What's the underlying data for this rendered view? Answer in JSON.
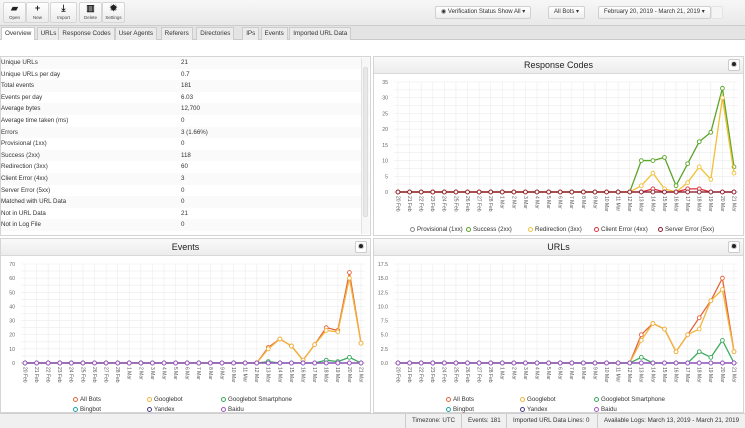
{
  "toolbar": {
    "buttons": [
      {
        "label": "Open",
        "icon": "folder-open-icon",
        "glyph": "▰"
      },
      {
        "label": "New",
        "icon": "plus-icon",
        "glyph": "+"
      },
      {
        "label": "Import",
        "icon": "download-icon",
        "glyph": "⤓"
      },
      {
        "label": "Delete",
        "icon": "trash-icon",
        "glyph": "▥"
      },
      {
        "label": "Settings",
        "icon": "gear-icon",
        "glyph": "✹"
      }
    ],
    "verification_filter": "Verification Status Show All",
    "bots_filter": "All Bots",
    "date_range": "February 20, 2019 - March 21, 2019"
  },
  "tabs": [
    "Overview",
    "URLs",
    "Response Codes",
    "User Agents",
    "Referers",
    "Directories",
    "IPs",
    "Events",
    "Imported URL Data"
  ],
  "active_tab": "Overview",
  "stats": [
    [
      "Unique URLs",
      "21"
    ],
    [
      "Unique URLs per day",
      "0.7"
    ],
    [
      "Total events",
      "181"
    ],
    [
      "Events per day",
      "6.03"
    ],
    [
      "Average bytes",
      "12,700"
    ],
    [
      "Average time taken (ms)",
      "0"
    ],
    [
      "Errors",
      "3 (1.66%)"
    ],
    [
      "Provisional (1xx)",
      "0"
    ],
    [
      "Success (2xx)",
      "118"
    ],
    [
      "Redirection (3xx)",
      "60"
    ],
    [
      "Client Error (4xx)",
      "3"
    ],
    [
      "Server Error (5xx)",
      "0"
    ],
    [
      "Matched with URL Data",
      "0"
    ],
    [
      "Not in URL Data",
      "21"
    ],
    [
      "Not in Log File",
      "0"
    ]
  ],
  "chart_data": [
    {
      "id": "response",
      "title": "Response Codes",
      "type": "line",
      "ylim": [
        0,
        35
      ],
      "yticks": [
        0,
        5,
        10,
        15,
        20,
        25,
        30,
        35
      ],
      "grid": true,
      "legend": "bottom",
      "categories": [
        "20 Feb",
        "21 Feb",
        "22 Feb",
        "23 Feb",
        "24 Feb",
        "25 Feb",
        "26 Feb",
        "27 Feb",
        "28 Feb",
        "1 Mar",
        "2 Mar",
        "3 Mar",
        "4 Mar",
        "5 Mar",
        "6 Mar",
        "7 Mar",
        "8 Mar",
        "9 Mar",
        "10 Mar",
        "11 Mar",
        "12 Mar",
        "13 Mar",
        "14 Mar",
        "15 Mar",
        "16 Mar",
        "17 Mar",
        "18 Mar",
        "19 Mar",
        "20 Mar",
        "21 Mar"
      ],
      "series": [
        {
          "name": "Provisional (1xx)",
          "color": "#8a8a8a",
          "values": [
            0,
            0,
            0,
            0,
            0,
            0,
            0,
            0,
            0,
            0,
            0,
            0,
            0,
            0,
            0,
            0,
            0,
            0,
            0,
            0,
            0,
            0,
            0,
            0,
            0,
            0,
            0,
            0,
            0,
            0
          ]
        },
        {
          "name": "Success (2xx)",
          "color": "#5aa52a",
          "values": [
            0,
            0,
            0,
            0,
            0,
            0,
            0,
            0,
            0,
            0,
            0,
            0,
            0,
            0,
            0,
            0,
            0,
            0,
            0,
            0,
            0,
            10,
            10,
            11,
            2,
            9,
            16,
            19,
            33,
            8
          ]
        },
        {
          "name": "Redirection (3xx)",
          "color": "#f0c038",
          "values": [
            0,
            0,
            0,
            0,
            0,
            0,
            0,
            0,
            0,
            0,
            0,
            0,
            0,
            0,
            0,
            0,
            0,
            0,
            0,
            0,
            0,
            2,
            6,
            1,
            0,
            3,
            8,
            4,
            30,
            6
          ]
        },
        {
          "name": "Client Error (4xx)",
          "color": "#d8323c",
          "values": [
            0,
            0,
            0,
            0,
            0,
            0,
            0,
            0,
            0,
            0,
            0,
            0,
            0,
            0,
            0,
            0,
            0,
            0,
            0,
            0,
            0,
            0,
            1,
            0,
            0,
            1,
            1,
            0,
            0,
            0
          ]
        },
        {
          "name": "Server Error (5xx)",
          "color": "#8e1c2e",
          "values": [
            0,
            0,
            0,
            0,
            0,
            0,
            0,
            0,
            0,
            0,
            0,
            0,
            0,
            0,
            0,
            0,
            0,
            0,
            0,
            0,
            0,
            0,
            0,
            0,
            0,
            0,
            0,
            0,
            0,
            0
          ]
        }
      ]
    },
    {
      "id": "events",
      "title": "Events",
      "type": "line",
      "ylim": [
        0,
        70
      ],
      "yticks": [
        0,
        10,
        20,
        30,
        40,
        50,
        60,
        70
      ],
      "grid": true,
      "legend": "bottom",
      "series": [
        {
          "name": "All Bots",
          "color": "#e4663a",
          "values": [
            0,
            0,
            0,
            0,
            0,
            0,
            0,
            0,
            0,
            0,
            0,
            0,
            0,
            0,
            0,
            0,
            0,
            0,
            0,
            0,
            0,
            11,
            17,
            12,
            2,
            13,
            25,
            23,
            64,
            14
          ]
        },
        {
          "name": "Googlebot",
          "color": "#f2b53c",
          "values": [
            0,
            0,
            0,
            0,
            0,
            0,
            0,
            0,
            0,
            0,
            0,
            0,
            0,
            0,
            0,
            0,
            0,
            0,
            0,
            0,
            0,
            10,
            17,
            12,
            2,
            13,
            23,
            22,
            60,
            14
          ]
        },
        {
          "name": "Googlebot Smartphone",
          "color": "#3aaa5c",
          "values": [
            0,
            0,
            0,
            0,
            0,
            0,
            0,
            0,
            0,
            0,
            0,
            0,
            0,
            0,
            0,
            0,
            0,
            0,
            0,
            0,
            0,
            1,
            0,
            0,
            0,
            0,
            2,
            1,
            4,
            0
          ]
        },
        {
          "name": "Bingbot",
          "color": "#1fa3a6",
          "values": [
            0,
            0,
            0,
            0,
            0,
            0,
            0,
            0,
            0,
            0,
            0,
            0,
            0,
            0,
            0,
            0,
            0,
            0,
            0,
            0,
            0,
            0,
            0,
            0,
            0,
            0,
            0,
            0,
            0,
            0
          ]
        },
        {
          "name": "Yandex",
          "color": "#4a3c8c",
          "values": [
            0,
            0,
            0,
            0,
            0,
            0,
            0,
            0,
            0,
            0,
            0,
            0,
            0,
            0,
            0,
            0,
            0,
            0,
            0,
            0,
            0,
            0,
            0,
            0,
            0,
            0,
            0,
            0,
            0,
            0
          ]
        },
        {
          "name": "Baidu",
          "color": "#a455c4",
          "values": [
            0,
            0,
            0,
            0,
            0,
            0,
            0,
            0,
            0,
            0,
            0,
            0,
            0,
            0,
            0,
            0,
            0,
            0,
            0,
            0,
            0,
            0,
            0,
            0,
            0,
            0,
            0,
            0,
            0,
            0
          ]
        }
      ]
    },
    {
      "id": "urls",
      "title": "URLs",
      "type": "line",
      "ylim": [
        0,
        17.5
      ],
      "yticks": [
        0,
        2.5,
        5,
        7.5,
        10,
        12.5,
        15,
        17.5
      ],
      "grid": true,
      "legend": "bottom",
      "series": [
        {
          "name": "All Bots",
          "color": "#e4663a",
          "values": [
            0,
            0,
            0,
            0,
            0,
            0,
            0,
            0,
            0,
            0,
            0,
            0,
            0,
            0,
            0,
            0,
            0,
            0,
            0,
            0,
            0,
            5,
            7,
            6,
            2,
            5,
            8,
            11,
            15,
            2
          ]
        },
        {
          "name": "Googlebot",
          "color": "#f2b53c",
          "values": [
            0,
            0,
            0,
            0,
            0,
            0,
            0,
            0,
            0,
            0,
            0,
            0,
            0,
            0,
            0,
            0,
            0,
            0,
            0,
            0,
            0,
            4,
            7,
            6,
            2,
            5,
            6,
            11,
            13,
            2
          ]
        },
        {
          "name": "Googlebot Smartphone",
          "color": "#3aaa5c",
          "values": [
            0,
            0,
            0,
            0,
            0,
            0,
            0,
            0,
            0,
            0,
            0,
            0,
            0,
            0,
            0,
            0,
            0,
            0,
            0,
            0,
            0,
            1,
            0,
            0,
            0,
            0,
            2,
            1,
            4,
            0
          ]
        },
        {
          "name": "Bingbot",
          "color": "#1fa3a6",
          "values": [
            0,
            0,
            0,
            0,
            0,
            0,
            0,
            0,
            0,
            0,
            0,
            0,
            0,
            0,
            0,
            0,
            0,
            0,
            0,
            0,
            0,
            0,
            0,
            0,
            0,
            0,
            0,
            0,
            0,
            0
          ]
        },
        {
          "name": "Yandex",
          "color": "#4a3c8c",
          "values": [
            0,
            0,
            0,
            0,
            0,
            0,
            0,
            0,
            0,
            0,
            0,
            0,
            0,
            0,
            0,
            0,
            0,
            0,
            0,
            0,
            0,
            0,
            0,
            0,
            0,
            0,
            0,
            0,
            0,
            0
          ]
        },
        {
          "name": "Baidu",
          "color": "#a455c4",
          "values": [
            0,
            0,
            0,
            0,
            0,
            0,
            0,
            0,
            0,
            0,
            0,
            0,
            0,
            0,
            0,
            0,
            0,
            0,
            0,
            0,
            0,
            0,
            0,
            0,
            0,
            0,
            0,
            0,
            0,
            0
          ]
        }
      ]
    }
  ],
  "status": {
    "timezone": "Timezone: UTC",
    "events": "Events: 181",
    "imported": "Imported URL Data Lines: 0",
    "available": "Available Logs: March 13, 2019 - March 21, 2019"
  }
}
